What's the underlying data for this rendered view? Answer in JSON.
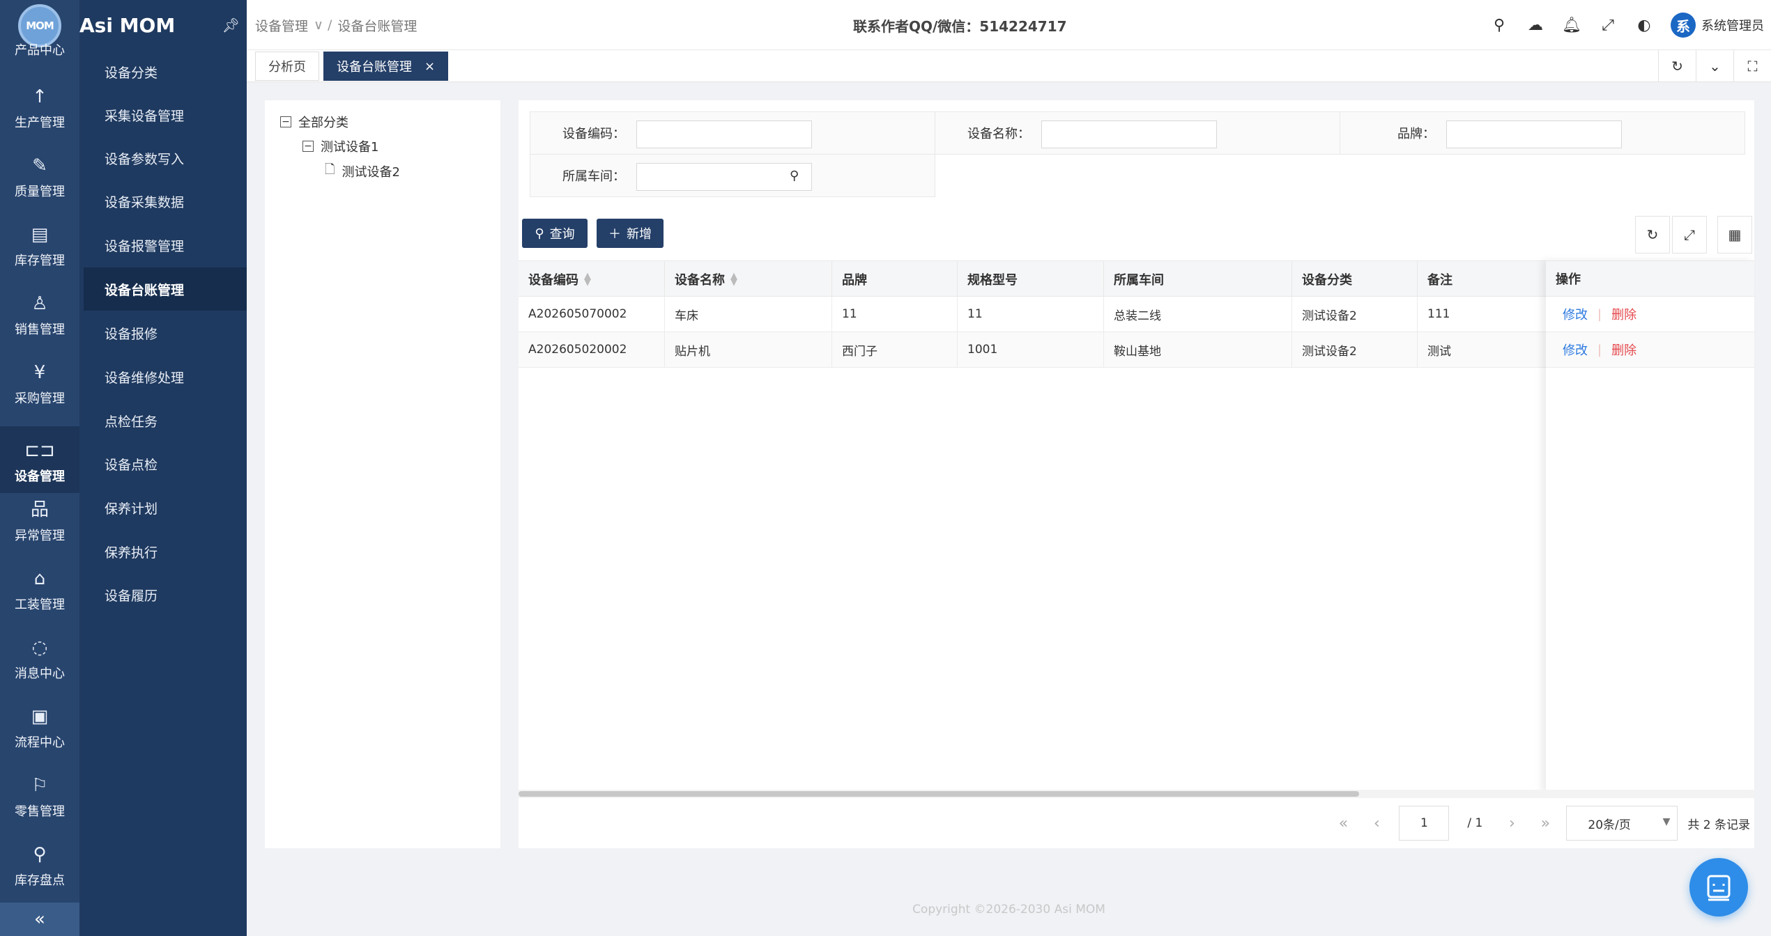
{
  "rail": {
    "logo_text": "MOM",
    "items": [
      {
        "label": "产品中心",
        "icon": "product-icon"
      },
      {
        "label": "生产管理",
        "icon": "arrow-up-icon"
      },
      {
        "label": "质量管理",
        "icon": "tool-icon"
      },
      {
        "label": "库存管理",
        "icon": "document-icon"
      },
      {
        "label": "销售管理",
        "icon": "rocket-icon"
      },
      {
        "label": "采购管理",
        "icon": "yen-icon"
      },
      {
        "label": "设备管理",
        "icon": "device-icon"
      },
      {
        "label": "异常管理",
        "icon": "org-icon"
      },
      {
        "label": "工装管理",
        "icon": "bank-icon"
      },
      {
        "label": "消息中心",
        "icon": "chat-icon"
      },
      {
        "label": "流程中心",
        "icon": "flow-icon"
      },
      {
        "label": "零售管理",
        "icon": "flag-icon"
      },
      {
        "label": "库存盘点",
        "icon": "search-doc-icon"
      }
    ],
    "collapse_glyph": "«"
  },
  "submenu": {
    "brand": "Asi MOM",
    "items": [
      "设备分类",
      "采集设备管理",
      "设备参数写入",
      "设备采集数据",
      "设备报警管理",
      "设备台账管理",
      "设备报修",
      "设备维修处理",
      "点检任务",
      "设备点检",
      "保养计划",
      "保养执行",
      "设备履历"
    ],
    "active_index": 5
  },
  "header": {
    "breadcrumb": [
      "设备管理",
      "设备台账管理"
    ],
    "contact": "联系作者QQ/微信：514224717",
    "avatar_char": "系",
    "user_name": "系统管理员"
  },
  "tabs": [
    {
      "label": "分析页"
    },
    {
      "label": "设备台账管理",
      "close": "×"
    }
  ],
  "tree": {
    "root": "全部分类",
    "child": "测试设备1",
    "grandchild": "测试设备2"
  },
  "query": {
    "code_label": "设备编码：",
    "name_label": "设备名称：",
    "brand_label": "品牌：",
    "workshop_label": "所属车间：",
    "code_value": "",
    "name_value": "",
    "brand_value": "",
    "workshop_value": ""
  },
  "buttons": {
    "query": "查询",
    "add": "新增"
  },
  "table": {
    "columns": [
      "设备编码",
      "设备名称",
      "品牌",
      "规格型号",
      "所属车间",
      "设备分类",
      "备注",
      "操作"
    ],
    "rows": [
      {
        "code": "A202605070002",
        "name": "车床",
        "brand": "11",
        "spec": "11",
        "workshop": "总装二线",
        "category": "测试设备2",
        "remark": "111"
      },
      {
        "code": "A202605020002",
        "name": "贴片机",
        "brand": "西门子",
        "spec": "1001",
        "workshop": "鞍山基地",
        "category": "测试设备2",
        "remark": "测试"
      }
    ],
    "edit_label": "修改",
    "delete_label": "删除"
  },
  "pager": {
    "page": "1",
    "total_pages": "/ 1",
    "page_size": "20条/页",
    "total": "共 2 条记录"
  },
  "footer": "Copyright ©2026-2030 Asi MOM",
  "colors": {
    "rail_bg": "#28456e",
    "submenu_bg": "#1f3a60",
    "primary": "#243f68",
    "link": "#2d7ae0",
    "danger": "#e5484d"
  }
}
